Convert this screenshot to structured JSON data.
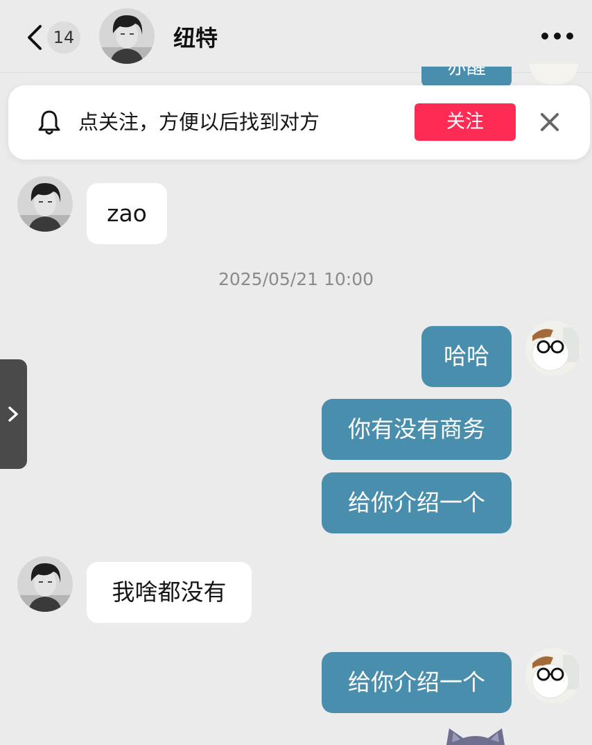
{
  "header": {
    "unread_count": "14",
    "title": "纽特"
  },
  "peek_message": {
    "text": "亦醒"
  },
  "follow_prompt": {
    "text": "点关注，方便以后找到对方",
    "button_label": "关注"
  },
  "messages": [
    {
      "sender": "other",
      "text": "zao"
    },
    {
      "timestamp": "2025/05/21 10:00"
    },
    {
      "sender": "me",
      "text": "哈哈"
    },
    {
      "sender": "me",
      "text": "你有没有商务"
    },
    {
      "sender": "me",
      "text": "给你介绍一个"
    },
    {
      "sender": "other",
      "text": "我啥都没有"
    },
    {
      "sender": "me",
      "text": "给你介绍一个"
    }
  ],
  "colors": {
    "background": "#ebebeb",
    "outgoing_bubble": "#4a8eae",
    "incoming_bubble": "#ffffff",
    "follow_button": "#fe2c55"
  },
  "icons": [
    "chevron-left-icon",
    "more-dots-icon",
    "bell-icon",
    "close-icon",
    "chevron-right-icon"
  ]
}
